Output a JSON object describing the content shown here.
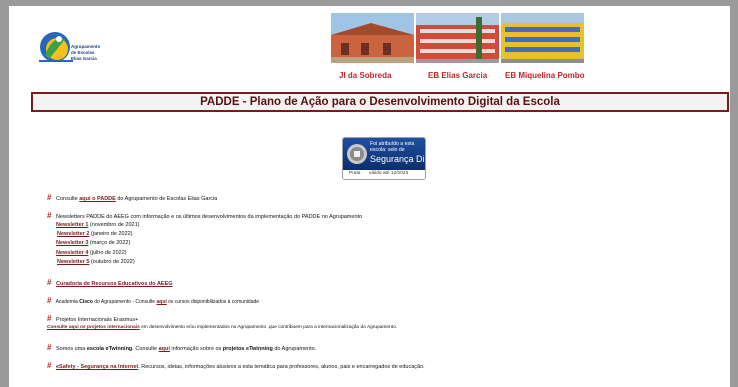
{
  "logo": {
    "line1": "Agrupamento",
    "line2": "de Escolas",
    "line3": "Elias Garcia"
  },
  "photos": [
    {
      "caption": "JI da Sobreda"
    },
    {
      "caption": "EB Elias Garcia"
    },
    {
      "caption": "EB Miquelina Pombo"
    }
  ],
  "banner": {
    "title": "PADDE - Plano de Ação para o Desenvolvimento Digital da Escola"
  },
  "seal": {
    "line1": "Foi atribuído a esta",
    "line2": "escola: selo de",
    "line3": "Segurança Digital",
    "level": "Prata",
    "validity": "válido até 12/2023"
  },
  "sections": {
    "padde": {
      "pre": "Consulte ",
      "link": "aqui o PADDE",
      "post": " do Agrupamento de Escolas Elias Garcia"
    },
    "newsletters": {
      "intro": "Newsletters PADDE do AEEG com informação e os últimos desenvolvimentos da implementação do PADDE no Agrupamento",
      "items": [
        {
          "link": "Newsletter 1",
          "date": " (novembro de 2021)"
        },
        {
          "link": "Newsletter 2",
          "date": " (janeiro de 2022)"
        },
        {
          "link": "Newsletter 3",
          "date": " (março de 2022)"
        },
        {
          "link": "Newsletter 4",
          "date": " (julho de 2022)"
        },
        {
          "link": "Newsletter 5",
          "date": " (outubro de 2022)"
        }
      ]
    },
    "curadoria": {
      "link": "Curadoria de Recursos Educativos do AEEG"
    },
    "cisco": {
      "pre": "Academia ",
      "bold": "Cisco",
      "mid": " do Agrupamento - Consulte ",
      "link": "aqui",
      "post": " os cursos disponibilizados à comunidade"
    },
    "erasmus": {
      "intro": "Projetos Internacionais Erasmus+",
      "link": "Consulte aqui os projetos internacionais",
      "post": " em desenvolvimento  e/ou implementados no Agrupamento ,que contribuem para a internacionalização do Agrupamento."
    },
    "etwinning": {
      "pre": "Somos uma ",
      "bold1": "escola eTwinning",
      "mid": ". Consulte ",
      "link": "aqui",
      "mid2": " informação sobre os ",
      "bold2": "projetos eTwinning",
      "post": " do Agrupamento."
    },
    "esafety": {
      "link": "eSafety - Segurança na Internet",
      "post": ". Recursos, ideias, informações alusivos a esta temática para professores, alunos, pais e encarregados de educação."
    }
  }
}
